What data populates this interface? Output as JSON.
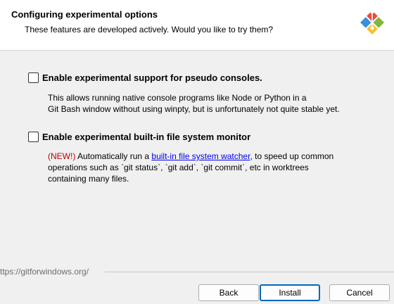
{
  "header": {
    "title": "Configuring experimental options",
    "subtitle": "These features are developed actively. Would you like to try them?",
    "logo_icon": "git-logo-icon"
  },
  "options": [
    {
      "label": "Enable experimental support for pseudo consoles.",
      "checked": false,
      "description_lines": [
        "This allows running native console programs like Node or Python in a",
        "Git Bash window without using winpty, but is unfortunately not quite stable yet."
      ]
    },
    {
      "label": "Enable experimental built-in file system monitor",
      "checked": false,
      "description": {
        "badge": "(NEW!)",
        "before_link": " Automatically run a ",
        "link_text": "built-in file system watcher",
        "after_link": ", to speed up common",
        "line2": "operations such as `git status`, `git add`, `git commit`, etc in worktrees",
        "line3": "containing many files."
      }
    }
  ],
  "footer": {
    "url": "ttps://gitforwindows.org/"
  },
  "buttons": {
    "back": "Back",
    "install": "Install",
    "cancel": "Cancel"
  },
  "colors": {
    "new_badge": "#c00000",
    "link": "#0000ee",
    "default_button_border": "#0067c0"
  }
}
